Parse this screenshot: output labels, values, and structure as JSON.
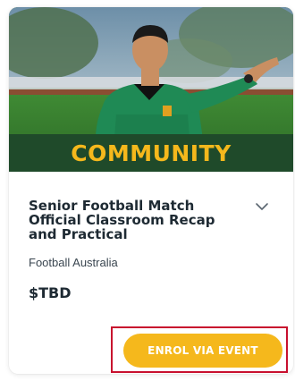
{
  "card": {
    "image_alt": "referee-photo",
    "banner_label": "COMMUNITY",
    "title": "Senior Football Match Official Classroom Recap and Practical",
    "organization": "Football Australia",
    "price": "$TBD",
    "enrol_button_label": "ENROL VIA EVENT"
  },
  "colors": {
    "banner_bg": "#1f4a2a",
    "banner_text": "#f5b81c",
    "button_bg": "#f5b81c",
    "button_text": "#ffffff",
    "highlight_border": "#c8102e",
    "title_text": "#1e2a33"
  },
  "icons": {
    "expand": "chevron-down-icon"
  }
}
